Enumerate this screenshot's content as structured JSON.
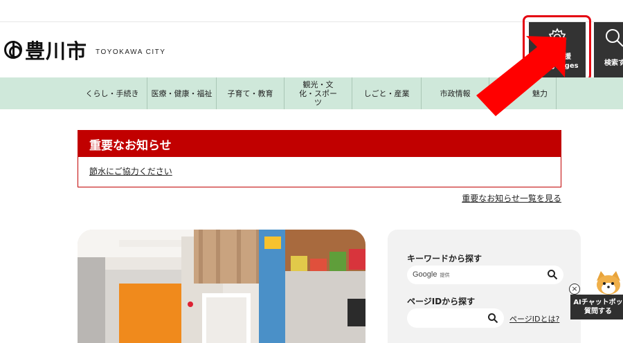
{
  "header": {
    "logo_text": "豊川市",
    "logo_sub": "TOYOKAWA CITY",
    "lang_button": {
      "label_line1": "閲覧支援",
      "label_line2": "Languages"
    },
    "search_button": {
      "label": "検索す"
    }
  },
  "nav": {
    "items": [
      {
        "label": "くらし・手続き"
      },
      {
        "label": "医療・健康・福祉"
      },
      {
        "label": "子育て・教育"
      },
      {
        "label": "観光・文化・スポーツ"
      },
      {
        "label": "しごと・産業"
      },
      {
        "label": "市政情報"
      },
      {
        "label": "魅力"
      }
    ]
  },
  "notice": {
    "heading": "重要なお知らせ",
    "item": "節水にご協力ください",
    "view_all": "重要なお知らせ一覧を見る"
  },
  "search_panel": {
    "keyword_title": "キーワードから探す",
    "google_label": "Google",
    "google_sub": "提供",
    "page_id_title": "ページIDから探す",
    "what_is_id": "ページIDとは?"
  },
  "ai_chat": {
    "line1": "AIチャットボッ",
    "line2": "質問する"
  },
  "colors": {
    "accent_red": "#c10000",
    "nav_green": "#cfe8da",
    "header_btn": "#333333"
  }
}
